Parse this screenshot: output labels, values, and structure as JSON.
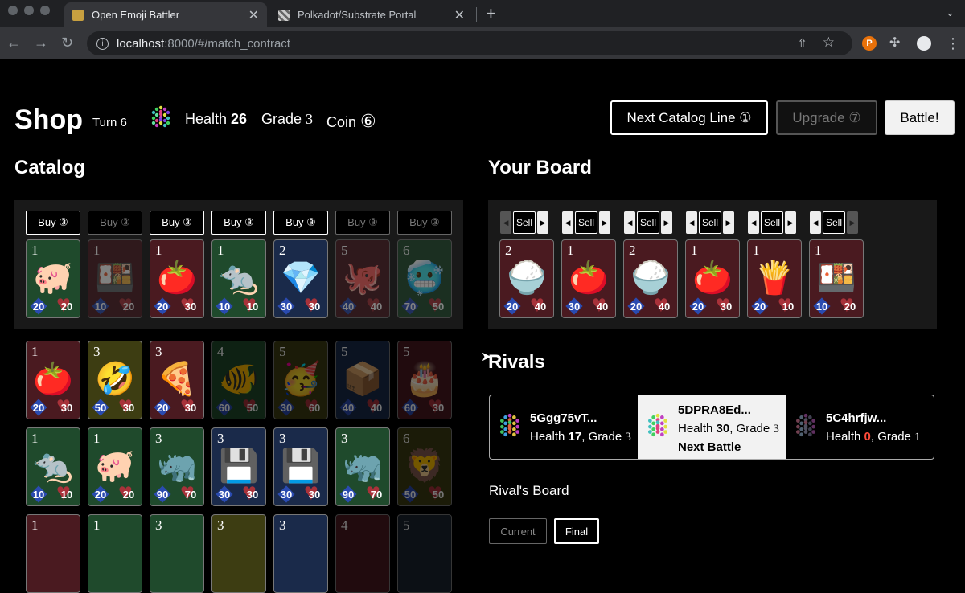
{
  "browser": {
    "tabs": [
      {
        "title": "Open Emoji Battler",
        "active": true
      },
      {
        "title": "Polkadot/Substrate Portal",
        "active": false
      }
    ],
    "url_host": "localhost",
    "url_path": ":8000/#/match_contract"
  },
  "header": {
    "title": "Shop",
    "turn": "Turn 6",
    "health_label": "Health",
    "health_value": "26",
    "grade_label": "Grade",
    "grade_value": "3",
    "coin_label": "Coin",
    "coin_value": "⑥",
    "next_catalog_label": "Next Catalog Line ①",
    "upgrade_label": "Upgrade ⑦",
    "battle_label": "Battle!"
  },
  "catalog": {
    "title": "Catalog",
    "buy_buttons": [
      {
        "label": "Buy ③",
        "enabled": true
      },
      {
        "label": "Buy ③",
        "enabled": false
      },
      {
        "label": "Buy ③",
        "enabled": true
      },
      {
        "label": "Buy ③",
        "enabled": true
      },
      {
        "label": "Buy ③",
        "enabled": true
      },
      {
        "label": "Buy ③",
        "enabled": false
      },
      {
        "label": "Buy ③",
        "enabled": false
      }
    ],
    "current_line": [
      {
        "grade": "1",
        "emoji": "🐖",
        "attack": "20",
        "health": "20",
        "color": "green",
        "dim": false
      },
      {
        "grade": "1",
        "emoji": "🍱",
        "attack": "10",
        "health": "20",
        "color": "red",
        "dim": true
      },
      {
        "grade": "1",
        "emoji": "🍅",
        "attack": "20",
        "health": "30",
        "color": "red",
        "dim": false
      },
      {
        "grade": "1",
        "emoji": "🐀",
        "attack": "10",
        "health": "10",
        "color": "green",
        "dim": false
      },
      {
        "grade": "2",
        "emoji": "💎",
        "attack": "30",
        "health": "30",
        "color": "blue",
        "dim": false
      },
      {
        "grade": "5",
        "emoji": "🐙",
        "attack": "40",
        "health": "40",
        "color": "red",
        "dim": true
      },
      {
        "grade": "6",
        "emoji": "🥶",
        "attack": "70",
        "health": "50",
        "color": "green",
        "dim": true
      }
    ],
    "rows": [
      [
        {
          "grade": "1",
          "emoji": "🍅",
          "attack": "20",
          "health": "30",
          "color": "red",
          "dim": false
        },
        {
          "grade": "3",
          "emoji": "🤣",
          "attack": "50",
          "health": "30",
          "color": "olive",
          "dim": false
        },
        {
          "grade": "3",
          "emoji": "🍕",
          "attack": "20",
          "health": "30",
          "color": "red",
          "dim": false
        },
        {
          "grade": "4",
          "emoji": "🐠",
          "attack": "60",
          "health": "50",
          "color": "green",
          "dim": true
        },
        {
          "grade": "5",
          "emoji": "🥳",
          "attack": "30",
          "health": "60",
          "color": "olive",
          "dim": true
        },
        {
          "grade": "5",
          "emoji": "📦",
          "attack": "40",
          "health": "40",
          "color": "blue",
          "dim": true
        },
        {
          "grade": "5",
          "emoji": "🎂",
          "attack": "60",
          "health": "30",
          "color": "red",
          "dim": true
        }
      ],
      [
        {
          "grade": "1",
          "emoji": "🐀",
          "attack": "10",
          "health": "10",
          "color": "green",
          "dim": false
        },
        {
          "grade": "1",
          "emoji": "🐖",
          "attack": "20",
          "health": "20",
          "color": "green",
          "dim": false
        },
        {
          "grade": "3",
          "emoji": "🦏",
          "attack": "90",
          "health": "70",
          "color": "green",
          "dim": false
        },
        {
          "grade": "3",
          "emoji": "💾",
          "attack": "30",
          "health": "30",
          "color": "blue",
          "dim": false
        },
        {
          "grade": "3",
          "emoji": "💾",
          "attack": "30",
          "health": "30",
          "color": "blue",
          "dim": false
        },
        {
          "grade": "3",
          "emoji": "🦏",
          "attack": "90",
          "health": "70",
          "color": "green",
          "dim": false
        },
        {
          "grade": "6",
          "emoji": "🦁",
          "attack": "50",
          "health": "50",
          "color": "olive",
          "dim": true
        }
      ],
      [
        {
          "grade": "1",
          "emoji": "",
          "attack": "",
          "health": "",
          "color": "red",
          "dim": false
        },
        {
          "grade": "1",
          "emoji": "",
          "attack": "",
          "health": "",
          "color": "green",
          "dim": false
        },
        {
          "grade": "3",
          "emoji": "",
          "attack": "",
          "health": "",
          "color": "green",
          "dim": false
        },
        {
          "grade": "3",
          "emoji": "",
          "attack": "",
          "health": "",
          "color": "olive",
          "dim": false
        },
        {
          "grade": "3",
          "emoji": "",
          "attack": "",
          "health": "",
          "color": "blue",
          "dim": false
        },
        {
          "grade": "4",
          "emoji": "",
          "attack": "",
          "health": "",
          "color": "red",
          "dim": true
        },
        {
          "grade": "5",
          "emoji": "",
          "attack": "",
          "health": "",
          "color": "grey",
          "dim": true
        }
      ]
    ]
  },
  "board": {
    "title": "Your Board",
    "sell_label": "Sell",
    "cards": [
      {
        "grade": "2",
        "emoji": "🍚",
        "attack": "20",
        "health": "40",
        "color": "red",
        "dim": false
      },
      {
        "grade": "1",
        "emoji": "🍅",
        "attack": "30",
        "health": "40",
        "color": "red",
        "dim": false
      },
      {
        "grade": "2",
        "emoji": "🍚",
        "attack": "20",
        "health": "40",
        "color": "red",
        "dim": false
      },
      {
        "grade": "1",
        "emoji": "🍅",
        "attack": "20",
        "health": "30",
        "color": "red",
        "dim": false
      },
      {
        "grade": "1",
        "emoji": "🍟",
        "attack": "20",
        "health": "10",
        "color": "red",
        "dim": false
      },
      {
        "grade": "1",
        "emoji": "🍱",
        "attack": "10",
        "health": "20",
        "color": "red",
        "dim": false
      }
    ]
  },
  "rivals": {
    "title": "Rivals",
    "list": [
      {
        "name": "5Ggg75vT...",
        "health_label": "Health",
        "health": "17",
        "grade_label": ", Grade",
        "grade": "3",
        "next": ""
      },
      {
        "name": "5DPRA8Ed...",
        "health_label": "Health",
        "health": "30",
        "grade_label": ", Grade",
        "grade": "3",
        "next": "Next Battle"
      },
      {
        "name": "5C4hrfjw...",
        "health_label": "Health",
        "health": "0",
        "grade_label": ", Grade",
        "grade": "1",
        "next": ""
      }
    ],
    "board_label": "Rival's Board",
    "board_tabs": [
      "Current",
      "Final"
    ]
  },
  "colors": {
    "green": "#1f4a2c",
    "red": "#4a1a20",
    "blue": "#1a2a4a",
    "olive": "#3d3d12",
    "grey": "#1c2430"
  }
}
